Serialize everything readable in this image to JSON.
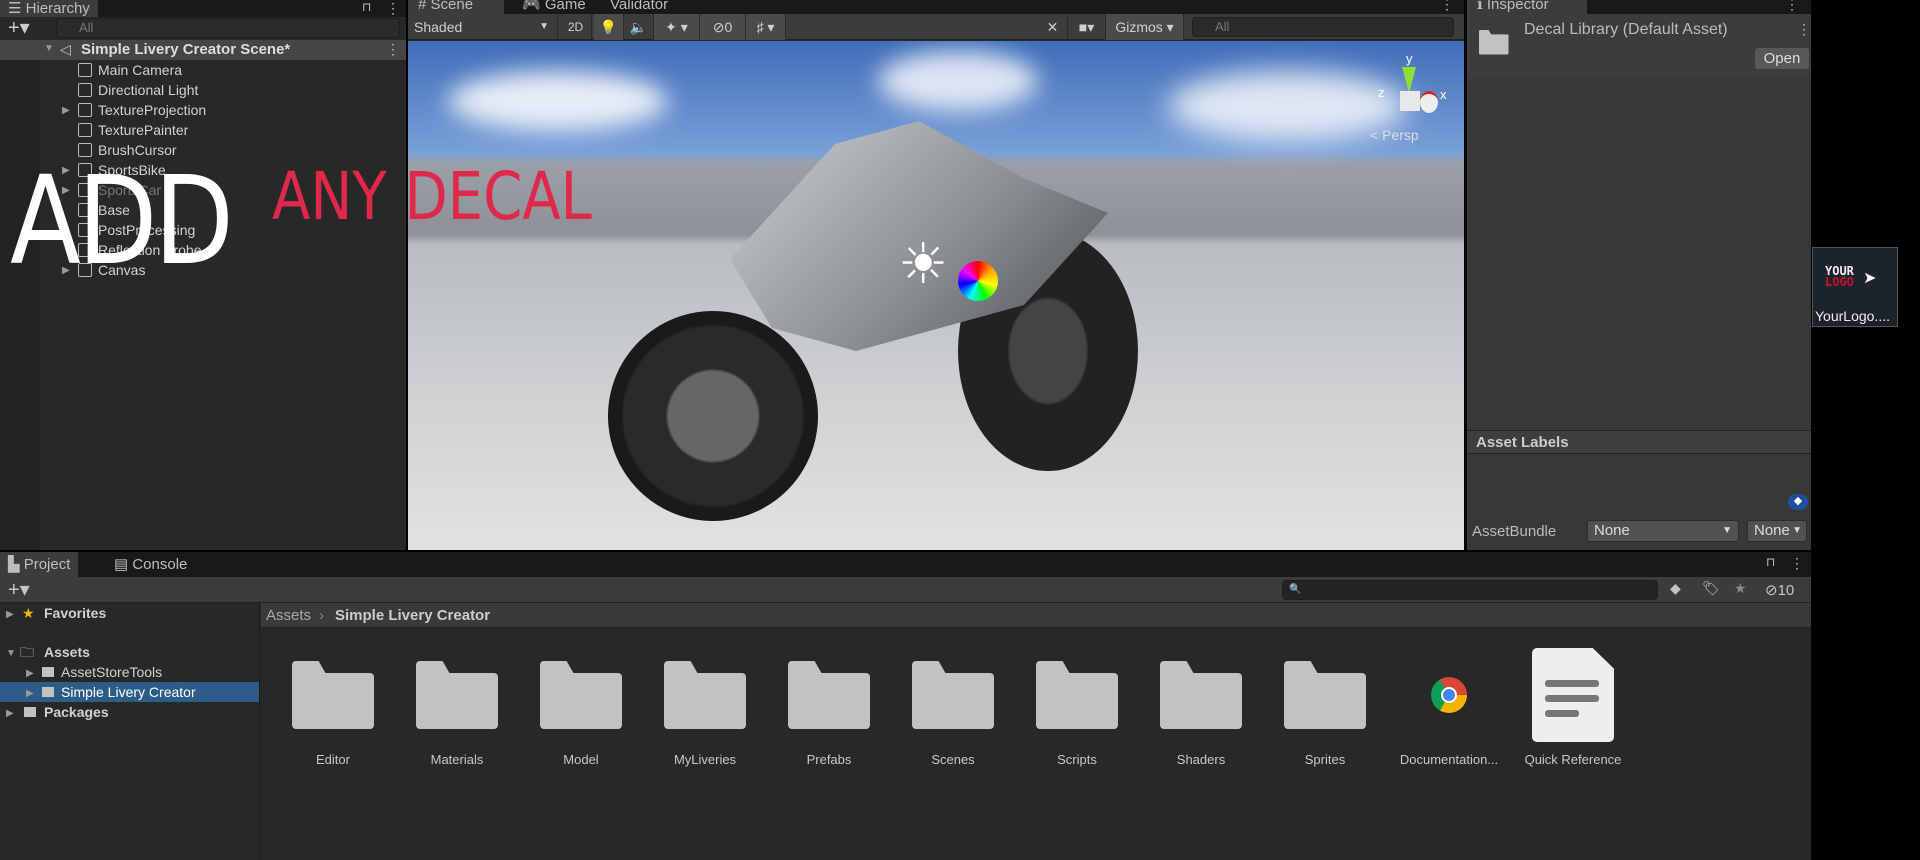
{
  "hierarchy": {
    "tab": "Hierarchy",
    "search_placeholder": "All",
    "scene": "Simple Livery Creator Scene*",
    "items": [
      {
        "label": "Main Camera",
        "expand": false
      },
      {
        "label": "Directional Light",
        "expand": false
      },
      {
        "label": "TextureProjection",
        "expand": true
      },
      {
        "label": "TexturePainter",
        "expand": false
      },
      {
        "label": "BrushCursor",
        "expand": false
      },
      {
        "label": "SportsBike",
        "expand": true
      },
      {
        "label": "SportsCar",
        "expand": true,
        "disabled": true
      },
      {
        "label": "Base",
        "expand": false
      },
      {
        "label": "PostProcessing",
        "expand": false
      },
      {
        "label": "Reflection Probe",
        "expand": false
      },
      {
        "label": "Canvas",
        "expand": true
      }
    ]
  },
  "scene": {
    "tabs": [
      "Scene",
      "Game",
      "Validator"
    ],
    "shading": "Shaded",
    "mode_2d": "2D",
    "hidden_count": "0",
    "gizmos": "Gizmos",
    "search_placeholder": "All",
    "projection": "Persp",
    "axes": {
      "x": "x",
      "y": "y",
      "z": "z"
    }
  },
  "overlay": {
    "word1": "ADD",
    "word2": "ANY",
    "word3": "DECAL",
    "color_white": "#ffffff",
    "color_red": "#e0284a"
  },
  "inspector": {
    "tab": "Inspector",
    "title": "Decal Library (Default Asset)",
    "open_button": "Open",
    "asset_labels": "Asset Labels",
    "assetbundle_label": "AssetBundle",
    "bundle_value": "None",
    "variant_value": "None"
  },
  "drag_item": {
    "label": "YourLogo....",
    "logo_top": "YOUR",
    "logo_bottom": "LOGO"
  },
  "project": {
    "tabs": [
      "Project",
      "Console"
    ],
    "hidden_count": "10",
    "tree": {
      "favorites": "Favorites",
      "assets": "Assets",
      "children": [
        "AssetStoreTools",
        "Simple Livery Creator"
      ],
      "packages": "Packages"
    },
    "breadcrumb": [
      "Assets",
      "Simple Livery Creator"
    ],
    "assets": [
      {
        "name": "Editor",
        "type": "folder"
      },
      {
        "name": "Materials",
        "type": "folder"
      },
      {
        "name": "Model",
        "type": "folder"
      },
      {
        "name": "MyLiveries",
        "type": "folder"
      },
      {
        "name": "Prefabs",
        "type": "folder"
      },
      {
        "name": "Scenes",
        "type": "folder"
      },
      {
        "name": "Scripts",
        "type": "folder"
      },
      {
        "name": "Shaders",
        "type": "folder"
      },
      {
        "name": "Sprites",
        "type": "folder"
      },
      {
        "name": "Documentation...",
        "type": "link"
      },
      {
        "name": "Quick Reference",
        "type": "document"
      }
    ]
  },
  "colors": {
    "selection": "#2c5d87",
    "panel": "#282828",
    "toolbar": "#3c3c3c"
  }
}
